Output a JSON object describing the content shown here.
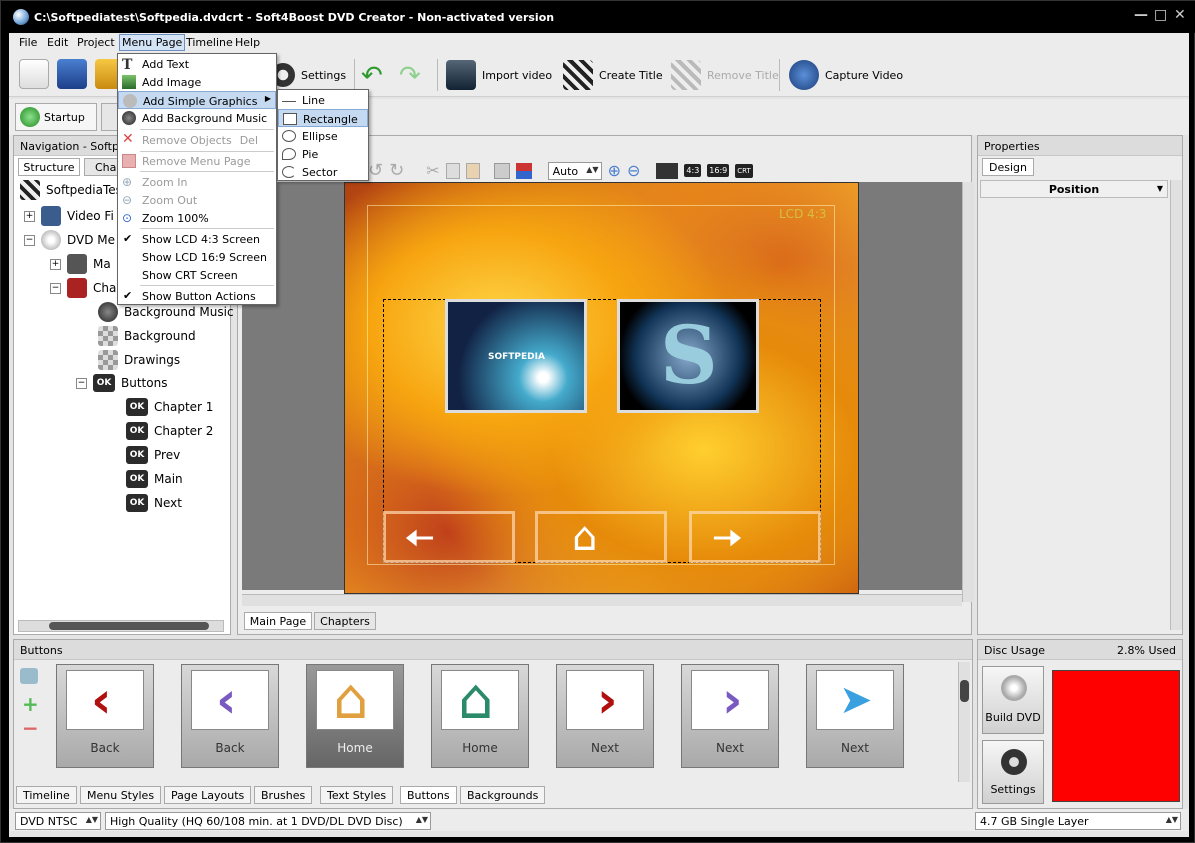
{
  "window": {
    "title": "C:\\Softpediatest\\Softpedia.dvdcrt - Soft4Boost DVD Creator - Non-activated version"
  },
  "menubar": {
    "items": [
      "File",
      "Edit",
      "Project",
      "Menu Page",
      "Timeline",
      "Help"
    ]
  },
  "toolbar": {
    "settings": "Settings",
    "import_video": "Import video",
    "create_title": "Create Title",
    "remove_title": "Remove Title",
    "capture_video": "Capture Video"
  },
  "tabs": {
    "startup": "Startup"
  },
  "nav": {
    "header": "Navigation - Softped",
    "tab_structure": "Structure",
    "tab_chapters": "Cha",
    "tree": {
      "root": "SoftpediaTes",
      "video": "Video Fi",
      "dvdmenu": "DVD Me",
      "main": "Ma",
      "chapters": "Cha",
      "bgmusic": "Background Music",
      "background": "Background",
      "drawings": "Drawings",
      "buttons": "Buttons",
      "ch1": "Chapter 1",
      "ch2": "Chapter 2",
      "prev": "Prev",
      "main_btn": "Main",
      "next": "Next",
      "ok": "OK"
    }
  },
  "editor": {
    "zoom": "Auto",
    "aspect43": "4:3",
    "aspect169": "16:9",
    "crt": "CRT",
    "lcd_label": "LCD 4:3",
    "tab_main": "Main Page",
    "tab_chapters": "Chapters",
    "thumb1_text": "SOFTPEDIA"
  },
  "properties": {
    "header": "Properties",
    "tab_design": "Design",
    "section": "Position"
  },
  "buttons_panel": {
    "header": "Buttons",
    "tiles": [
      "Back",
      "Back",
      "Home",
      "Home",
      "Next",
      "Next",
      "Next"
    ]
  },
  "bottom_tabs": [
    "Timeline",
    "Menu Styles",
    "Page Layouts",
    "Brushes",
    "Text Styles",
    "Buttons",
    "Backgrounds"
  ],
  "disc": {
    "header": "Disc Usage",
    "used": "2.8% Used",
    "build": "Build DVD",
    "settings": "Settings",
    "fill_color": "#ff0000"
  },
  "status": {
    "format": "DVD NTSC",
    "quality": "High Quality (HQ 60/108 min. at 1 DVD/DL DVD Disc)",
    "disc": "4.7 GB Single Layer"
  },
  "menu_page_dropdown": {
    "add_text": "Add Text",
    "add_image": "Add Image",
    "add_simple_graphics": "Add Simple Graphics",
    "add_bg_music": "Add Background Music",
    "remove_objects": "Remove Objects",
    "remove_objects_short": "Del",
    "remove_menu_page": "Remove Menu Page",
    "zoom_in": "Zoom In",
    "zoom_out": "Zoom Out",
    "zoom_100": "Zoom 100%",
    "show_lcd43": "Show LCD 4:3 Screen",
    "show_lcd169": "Show LCD 16:9 Screen",
    "show_crt": "Show CRT Screen",
    "show_button_actions": "Show Button Actions"
  },
  "submenu": {
    "line": "Line",
    "rectangle": "Rectangle",
    "ellipse": "Ellipse",
    "pie": "Pie",
    "sector": "Sector"
  }
}
